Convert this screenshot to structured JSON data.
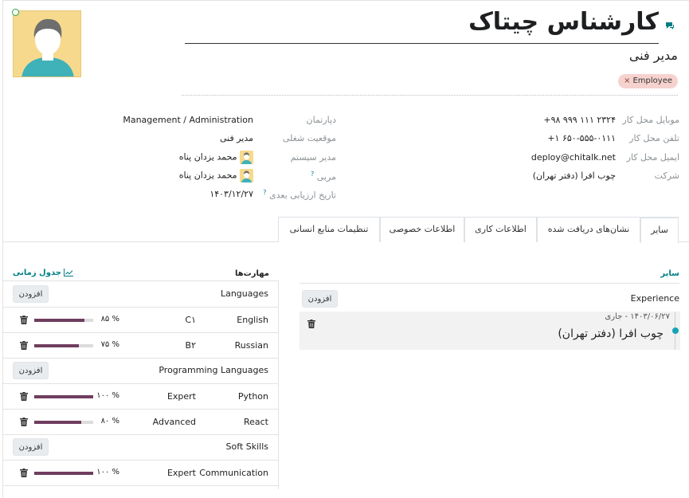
{
  "employee": {
    "name": "کارشناس چیتاک",
    "job_title": "مدیر فنی",
    "tag": "Employee",
    "tag_remove": "×"
  },
  "left_fields": [
    {
      "label": "موبایل محل کار",
      "value": "+۹۸ ۹۹۹ ۱۱۱ ۲۳۲۴"
    },
    {
      "label": "تلفن محل کار",
      "value": "+۱ ۶۵۰-۵۵۵-۰۱۱۱"
    },
    {
      "label": "ایمیل محل کار",
      "value": "deploy@chitalk.net"
    },
    {
      "label": "شرکت",
      "value": "چوب افرا (دفتر تهران)"
    }
  ],
  "right_fields": [
    {
      "label": "دپارتمان",
      "value": "Management / Administration"
    },
    {
      "label": "موقعیت شغلی",
      "value": "مدیر فنی"
    },
    {
      "label": "مدیر سیستم",
      "value": "محمد یزدان پناه"
    },
    {
      "label": "مربی",
      "value": "محمد یزدان پناه",
      "help": "?"
    },
    {
      "label": "تاریخ ارزیابی بعدی",
      "value": "۱۴۰۳/۱۲/۲۷",
      "help": "?"
    }
  ],
  "tabs": [
    "سایر",
    "نشان‌های دریافت شده",
    "اطلاعات کاری",
    "اطلاعات خصوصی",
    "تنظیمات منابع انسانی"
  ],
  "other_section": {
    "title": "سایر",
    "resume_group": "Experience",
    "add_label": "افزودن",
    "entry_date": "۱۴۰۳/۰۶/۲۷ - جاری",
    "entry_title": "چوب افرا (دفتر تهران)"
  },
  "skills": {
    "title": "مهارت‌ها",
    "timeline_label": "جدول زمانی",
    "add_label": "افزودن",
    "groups": [
      {
        "name": "Languages",
        "items": [
          {
            "name": "English",
            "level": "C۱",
            "percent": "۸۵ %",
            "progress": 85
          },
          {
            "name": "Russian",
            "level": "B۲",
            "percent": "۷۵ %",
            "progress": 75
          }
        ]
      },
      {
        "name": "Programming Languages",
        "items": [
          {
            "name": "Python",
            "level": "Expert",
            "percent": "۱۰۰ %",
            "progress": 100
          },
          {
            "name": "React",
            "level": "Advanced",
            "percent": "۸۰ %",
            "progress": 80
          }
        ]
      },
      {
        "name": "Soft Skills",
        "items": [
          {
            "name": "Communication",
            "level": "Expert",
            "percent": "۱۰۰ %",
            "progress": 100
          }
        ]
      }
    ]
  },
  "colors": {
    "accent": "#017e84",
    "bar": "#6f3d5f",
    "tag_bg": "#f6d2cf"
  },
  "icons": {
    "chat": "chat-icon",
    "trash": "trash-icon",
    "chart": "chart-icon"
  }
}
